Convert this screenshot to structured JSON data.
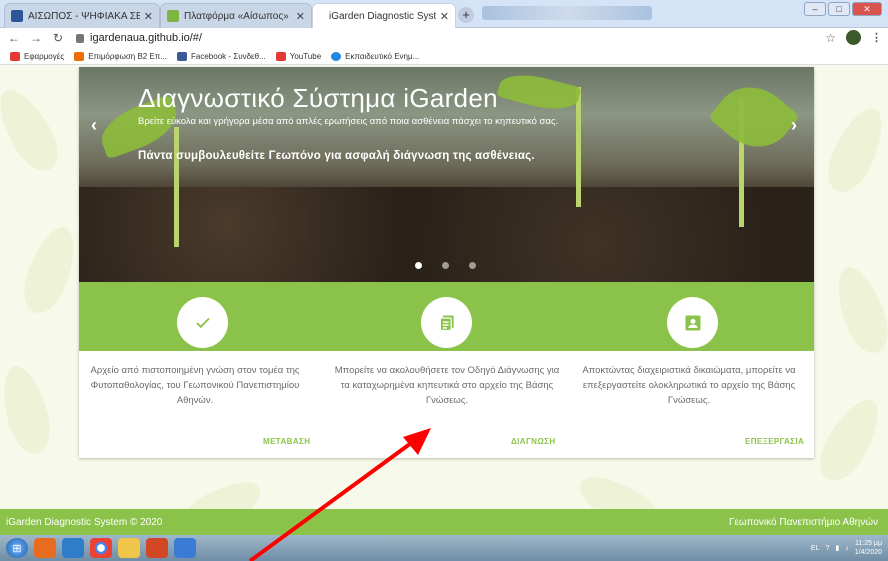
{
  "browser": {
    "tabs": [
      {
        "title": "ΑΙΣΩΠΟΣ - ΨΗΦΙΑΚΑ ΣΕΝΑΡΙΑ",
        "color": "#2b579a"
      },
      {
        "title": "Πλατφόρμα «Αίσωπος» - Ψηφι",
        "color": "#7cb342"
      },
      {
        "title": "iGarden Diagnostic System",
        "color": "#ffffff"
      }
    ],
    "url": "igardenaua.github.io/#/",
    "bookmarks": [
      {
        "label": "Εφαρμογές",
        "color": "#e53935"
      },
      {
        "label": "Επιμόρφωση Β2 Επ...",
        "color": "#ef6c00"
      },
      {
        "label": "Facebook - Συνδεθ...",
        "color": "#3b5998"
      },
      {
        "label": "YouTube",
        "color": "#e53935"
      },
      {
        "label": "Εκπαιδευτικό Ενημ...",
        "color": "#1e88e5"
      }
    ]
  },
  "hero": {
    "title": "Διαγνωστικό Σύστημα iGarden",
    "subtitle": "Βρείτε εύκολα και γρήγορα μέσα από απλές ερωτήσεις από ποια ασθένεια πάσχει το κηπευτικό σας.",
    "note": "Πάντα συμβουλευθείτε Γεωπόνο για ασφαλή διάγνωση της ασθένειας.",
    "prev": "‹",
    "next": "›",
    "slides_total": 3,
    "slide_active": 1
  },
  "features": [
    {
      "icon": "check-icon",
      "text": "Αρχείο από πιστοποιημένη γνώση στον τομέα της Φυτοπαθολογίας, του Γεωπονικού Πανεπιστημίου Αθηνών.",
      "link": "ΜΕΤΑΒΑΣΗ"
    },
    {
      "icon": "document-icon",
      "text": "Μπορείτε να ακολουθήσετε τον Οδηγό Διάγνωσης για τα καταχωρημένα κηπευτικά στο αρχείο της Βάσης Γνώσεως.",
      "link": "ΔΙΑΓΝΩΣΗ"
    },
    {
      "icon": "person-icon",
      "text": "Αποκτώντας διαχειριστικά δικαιώματα, μπορείτε να επεξεργαστείτε ολοκληρωτικά το αρχείο της Βάσης Γνώσεως.",
      "link": "ΕΠΕΞΕΡΓΑΣΙΑ"
    }
  ],
  "footer": {
    "left": "iGarden Diagnostic System © 2020",
    "right": "Γεωπονικό Πανεπιστήμιο Αθηνών"
  },
  "taskbar": {
    "lang": "EL",
    "time": "11:25 μμ",
    "date": "1/4/2020"
  },
  "colors": {
    "accent": "#8bc34a",
    "annotation_arrow": "#ff0000"
  }
}
